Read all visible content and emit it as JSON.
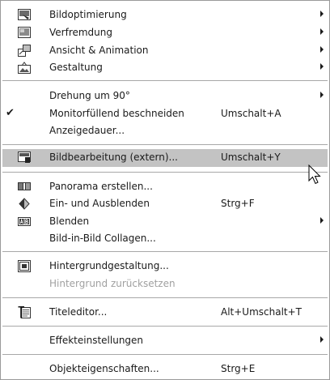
{
  "menu": {
    "groups": [
      [
        {
          "label": "Bildoptimierung",
          "icon": "image-optimize-icon",
          "submenu": true
        },
        {
          "label": "Verfremdung",
          "icon": "alienation-icon",
          "submenu": true
        },
        {
          "label": "Ansicht & Animation",
          "icon": "view-animation-icon",
          "submenu": true
        },
        {
          "label": "Gestaltung",
          "icon": "design-icon",
          "submenu": true
        }
      ],
      [
        {
          "label": "Drehung um 90°",
          "submenu": true
        },
        {
          "label": "Monitorfüllend beschneiden",
          "shortcut": "Umschalt+A",
          "checked": true
        },
        {
          "label": "Anzeigedauer..."
        }
      ],
      [
        {
          "label": "Bildbearbeitung (extern)...",
          "icon": "external-edit-icon",
          "shortcut": "Umschalt+Y",
          "highlighted": true
        }
      ],
      [
        {
          "label": "Panorama erstellen...",
          "icon": "panorama-icon"
        },
        {
          "label": "Ein- und Ausblenden",
          "icon": "fade-icon",
          "shortcut": "Strg+F"
        },
        {
          "label": "Blenden",
          "icon": "blend-ab-icon",
          "submenu": true
        },
        {
          "label": "Bild-in-Bild Collagen..."
        }
      ],
      [
        {
          "label": "Hintergrundgestaltung...",
          "icon": "background-icon"
        },
        {
          "label": "Hintergrund zurücksetzen",
          "disabled": true
        }
      ],
      [
        {
          "label": "Titeleditor...",
          "icon": "title-editor-icon",
          "shortcut": "Alt+Umschalt+T"
        }
      ],
      [
        {
          "label": "Effekteinstellungen",
          "submenu": true
        }
      ],
      [
        {
          "label": "Objekteigenschaften...",
          "shortcut": "Strg+E"
        }
      ]
    ]
  }
}
